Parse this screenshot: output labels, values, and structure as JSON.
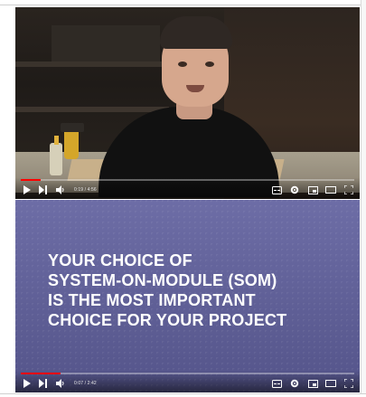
{
  "players": [
    {
      "id": "player-1",
      "time": {
        "current": "0:19",
        "sep": " / ",
        "total": "4:56"
      },
      "progress": 0.06
    },
    {
      "id": "player-2",
      "caption": "YOUR CHOICE OF\nSYSTEM-ON-MODULE (SOM)\nIS THE MOST IMPORTANT\nCHOICE FOR YOUR PROJECT",
      "time": {
        "current": "0:07",
        "sep": " / ",
        "total": "2:42"
      },
      "progress": 0.12
    }
  ],
  "icons": {
    "play": "play-icon",
    "next": "next-icon",
    "volume": "volume-icon",
    "subtitles": "subtitles-icon",
    "settings": "gear-icon",
    "miniplayer": "miniplayer-icon",
    "theater": "theater-icon",
    "fullscreen": "fullscreen-icon"
  },
  "colors": {
    "progress": "#ff0000",
    "caption_bg": "#6a6aa0"
  }
}
